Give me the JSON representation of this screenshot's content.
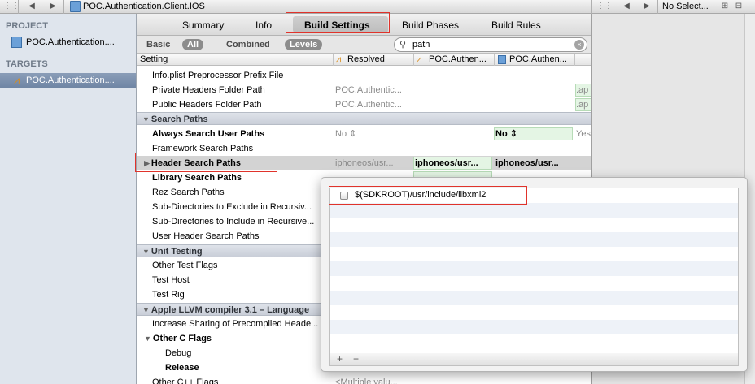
{
  "titlebar": {
    "title": "POC.Authentication.Client.IOS",
    "no_selection": "No Select...",
    "grid_glyph": "⋮⋮",
    "back_glyph": "◀",
    "fwd_glyph": "▶",
    "plus_glyph": "⊞",
    "minus_glyph": "⊟"
  },
  "sidebar": {
    "project_header": "PROJECT",
    "project_item": "POC.Authentication....",
    "targets_header": "TARGETS",
    "target_item": "POC.Authentication...."
  },
  "tabs": [
    "Summary",
    "Info",
    "Build Settings",
    "Build Phases",
    "Build Rules"
  ],
  "filter": {
    "basic": "Basic",
    "all": "All",
    "combined": "Combined",
    "levels": "Levels",
    "search_value": "path"
  },
  "columns": {
    "setting": "Setting",
    "resolved": "Resolved",
    "col2": "POC.Authen...",
    "col3": "POC.Authen..."
  },
  "rows": [
    {
      "name": "Info.plist Preprocessor Prefix File"
    },
    {
      "name": "Private Headers Folder Path",
      "v1": "POC.Authentic...",
      "v4": ".ap"
    },
    {
      "name": "Public Headers Folder Path",
      "v1": "POC.Authentic...",
      "v4": ".ap"
    },
    {
      "section": "Search Paths"
    },
    {
      "name": "Always Search User Paths",
      "v1": "No ⇕",
      "v3": "No ⇕",
      "v4": "Yes"
    },
    {
      "name": "Framework Search Paths"
    },
    {
      "name": "Header Search Paths",
      "v1": "iphoneos/usr...",
      "v2": "iphoneos/usr...",
      "v3": "iphoneos/usr..."
    },
    {
      "name": "Library Search Paths"
    },
    {
      "name": "Rez Search Paths"
    },
    {
      "name": "Sub-Directories to Exclude in Recursiv..."
    },
    {
      "name": "Sub-Directories to Include in Recursive..."
    },
    {
      "name": "User Header Search Paths"
    },
    {
      "section": "Unit Testing"
    },
    {
      "name": "Other Test Flags"
    },
    {
      "name": "Test Host"
    },
    {
      "name": "Test Rig"
    },
    {
      "section": "Apple LLVM compiler 3.1 – Language"
    },
    {
      "name": "Increase Sharing of Precompiled Heade..."
    },
    {
      "name": "Other C Flags"
    },
    {
      "name": "Debug"
    },
    {
      "name": "Release"
    },
    {
      "name": "Other C++ Flags",
      "v1": "<Multiple valu..."
    }
  ],
  "popup": {
    "items": [
      "$(SDKROOT)/usr/include/libxml2"
    ],
    "add": "+",
    "remove": "−"
  }
}
